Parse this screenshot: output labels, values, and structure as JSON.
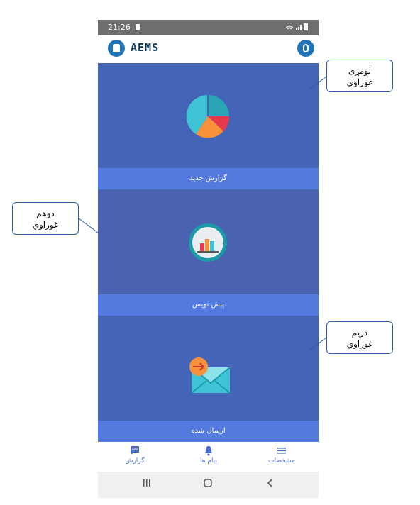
{
  "statusbar": {
    "time": "21:26",
    "signal_icons": "wifi-signal-battery"
  },
  "appbar": {
    "logo_text": "AEMS",
    "profile_icon": "user-lock-icon"
  },
  "cards": [
    {
      "label": "گزارش جدید",
      "icon": "pie-chart-icon",
      "colors": {
        "bg": "#4464b7",
        "bar": "#5479df"
      }
    },
    {
      "label": "پیش نویس",
      "icon": "bar-chart-icon",
      "colors": {
        "bg": "#4a62b0",
        "bar": "#5479df"
      }
    },
    {
      "label": "ارسال شده",
      "icon": "sent-mail-icon",
      "colors": {
        "bg": "#4464b7",
        "bar": "#5479df"
      }
    }
  ],
  "bottomnav": [
    {
      "label": "گزارش",
      "icon": "report-icon"
    },
    {
      "label": "پیام ها",
      "icon": "bell-icon"
    },
    {
      "label": "مشخصات",
      "icon": "menu-icon"
    }
  ],
  "callouts": [
    {
      "line1": "لومړی",
      "line2": "غوراوي"
    },
    {
      "line1": "دوهم",
      "line2": "غوراوي"
    },
    {
      "line1": "دریم",
      "line2": "غوراوي"
    }
  ]
}
